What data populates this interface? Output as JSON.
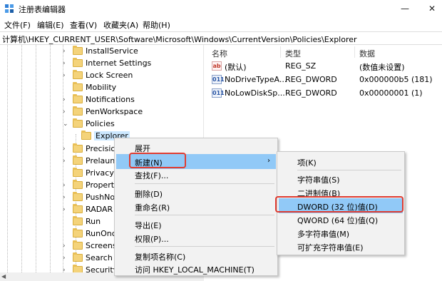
{
  "window": {
    "title": "注册表编辑器",
    "minimize": "—",
    "close": "✕"
  },
  "icons": {
    "app": "regedit-icon",
    "folder": "folder-icon",
    "value_sz": "string-value-icon",
    "value_dword": "dword-value-icon"
  },
  "menu": [
    "文件(F)",
    "编辑(E)",
    "查看(V)",
    "收藏夹(A)",
    "帮助(H)"
  ],
  "address": "计算机\\HKEY_CURRENT_USER\\Software\\Microsoft\\Windows\\CurrentVersion\\Policies\\Explorer",
  "tree": {
    "items": [
      {
        "label": "InstallService"
      },
      {
        "label": "Internet Settings"
      },
      {
        "label": "Lock Screen"
      },
      {
        "label": "Mobility"
      },
      {
        "label": "Notifications"
      },
      {
        "label": "PenWorkspace"
      },
      {
        "label": "Policies"
      },
      {
        "label": "Explorer"
      },
      {
        "label": "Precisio"
      },
      {
        "label": "Prelaunc"
      },
      {
        "label": "Privacy"
      },
      {
        "label": "Property"
      },
      {
        "label": "PushNot"
      },
      {
        "label": "RADAR"
      },
      {
        "label": "Run"
      },
      {
        "label": "RunOnce"
      },
      {
        "label": "Screensa"
      },
      {
        "label": "Search"
      },
      {
        "label": "Security"
      }
    ]
  },
  "values": {
    "headers": {
      "name": "名称",
      "type": "类型",
      "data": "数据"
    },
    "rows": [
      {
        "icon": "ab",
        "name": "(默认)",
        "type": "REG_SZ",
        "data": "(数值未设置)"
      },
      {
        "icon": "011",
        "name": "NoDriveTypeA...",
        "type": "REG_DWORD",
        "data": "0x000000b5 (181)"
      },
      {
        "icon": "011",
        "name": "NoLowDiskSp...",
        "type": "REG_DWORD",
        "data": "0x00000001 (1)"
      }
    ]
  },
  "context_menu": {
    "items": [
      "展开",
      "新建(N)",
      "查找(F)...",
      "删除(D)",
      "重命名(R)",
      "导出(E)",
      "权限(P)...",
      "复制项名称(C)",
      "访问 HKEY_LOCAL_MACHINE(T)"
    ],
    "submenu_arrow": "›"
  },
  "submenu": {
    "items": [
      "项(K)",
      "字符串值(S)",
      "二进制值(B)",
      "DWORD (32 位)值(D)",
      "QWORD (64 位)值(Q)",
      "多字符串值(M)",
      "可扩充字符串值(E)"
    ]
  },
  "colors": {
    "highlight": "#91c9f7",
    "annotation": "#e03c31",
    "selection": "#cce8ff"
  }
}
